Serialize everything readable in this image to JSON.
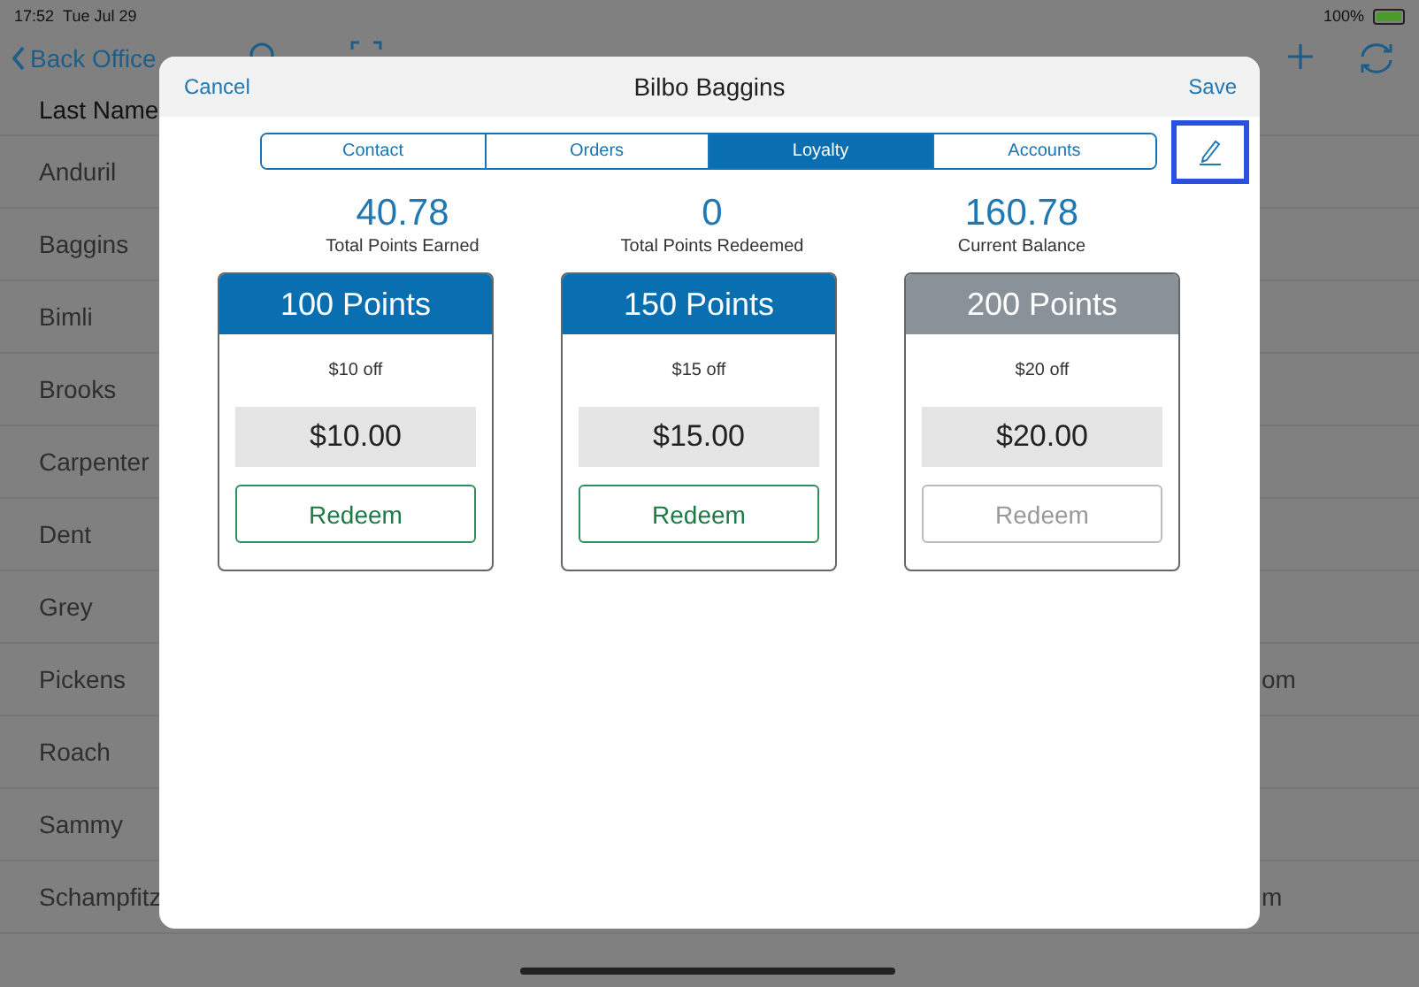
{
  "status_bar": {
    "time": "17:52",
    "date": "Tue Jul 29",
    "battery": "100%"
  },
  "nav": {
    "back": "Back Office"
  },
  "list": {
    "column_1": "Last Name",
    "rows": [
      {
        "last_name": "Anduril"
      },
      {
        "last_name": "Baggins"
      },
      {
        "last_name": "Bimli"
      },
      {
        "last_name": "Brooks"
      },
      {
        "last_name": "Carpenter"
      },
      {
        "last_name": "Dent"
      },
      {
        "last_name": "Grey"
      },
      {
        "last_name": "Pickens",
        "email": "om"
      },
      {
        "last_name": "Roach"
      },
      {
        "last_name": "Sammy"
      },
      {
        "last_name": "Schampfitz",
        "email": "m"
      }
    ]
  },
  "modal": {
    "title": "Bilbo Baggins",
    "cancel": "Cancel",
    "save": "Save",
    "tabs": [
      {
        "label": "Contact",
        "selected": false
      },
      {
        "label": "Orders",
        "selected": false
      },
      {
        "label": "Loyalty",
        "selected": true
      },
      {
        "label": "Accounts",
        "selected": false
      }
    ],
    "edit_button": {
      "highlighted": true
    },
    "stats": [
      {
        "value": "40.78",
        "label": "Total Points Earned"
      },
      {
        "value": "0",
        "label": "Total Points Redeemed"
      },
      {
        "value": "160.78",
        "label": "Current Balance"
      }
    ],
    "rewards": [
      {
        "points": "100 Points",
        "description": "$10 off",
        "amount": "$10.00",
        "button": "Redeem",
        "disabled": false
      },
      {
        "points": "150 Points",
        "description": "$15 off",
        "amount": "$15.00",
        "button": "Redeem",
        "disabled": false
      },
      {
        "points": "200 Points",
        "description": "$20 off",
        "amount": "$20.00",
        "button": "Redeem",
        "disabled": true
      }
    ]
  }
}
